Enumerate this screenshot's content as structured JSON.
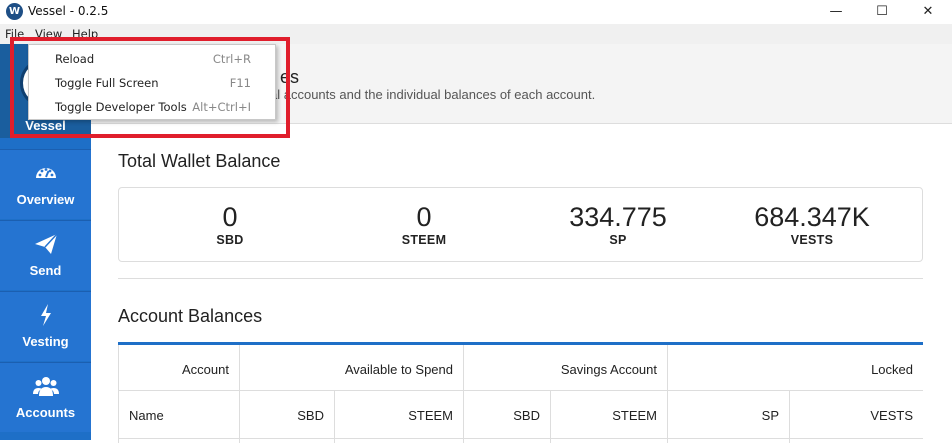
{
  "window": {
    "title": "Vessel - 0.2.5",
    "minimize": "—",
    "maximize": "☐",
    "close": "✕"
  },
  "menubar": {
    "file": "File",
    "view": "View",
    "help": "Help"
  },
  "dropdown": {
    "items": [
      {
        "label": "Reload",
        "shortcut": "Ctrl+R"
      },
      {
        "label": "Toggle Full Screen",
        "shortcut": "F11"
      },
      {
        "label": "Toggle Developer Tools",
        "shortcut": "Alt+Ctrl+I"
      }
    ]
  },
  "sidebar": {
    "brand": "Vessel",
    "items": [
      {
        "label": "Overview",
        "icon": "gauge-icon"
      },
      {
        "label": "Send",
        "icon": "paper-plane-icon"
      },
      {
        "label": "Vesting",
        "icon": "lightning-icon"
      },
      {
        "label": "Accounts",
        "icon": "users-icon"
      }
    ]
  },
  "header": {
    "title_visible": "es",
    "subtitle_visible": "al accounts and the individual balances of each account."
  },
  "total_balance": {
    "title": "Total Wallet Balance",
    "stats": [
      {
        "value": "0",
        "unit": "SBD"
      },
      {
        "value": "0",
        "unit": "STEEM"
      },
      {
        "value": "334.775",
        "unit": "SP"
      },
      {
        "value": "684.347K",
        "unit": "VESTS"
      }
    ]
  },
  "account_balances": {
    "title": "Account Balances",
    "group_headers": [
      "Account",
      "Available to Spend",
      "Savings Account",
      "Locked"
    ],
    "column_headers": [
      "Name",
      "SBD",
      "STEEM",
      "SBD",
      "STEEM",
      "SP",
      "VESTS"
    ]
  },
  "colors": {
    "sidebar": "#1e6fc7",
    "brand": "#1a5e9e",
    "highlight": "#e01e2c"
  }
}
